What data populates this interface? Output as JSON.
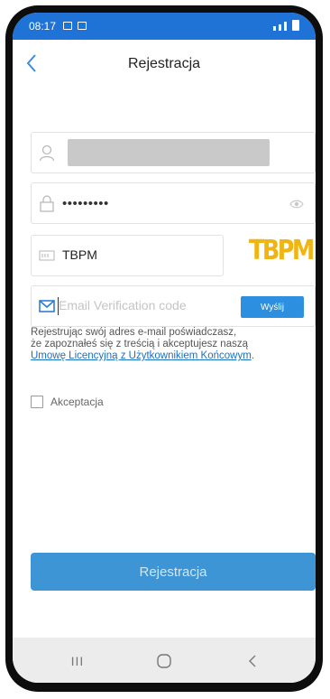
{
  "status_bar": {
    "time": "08:17"
  },
  "header": {
    "title": "Rejestracja",
    "back_icon": "chevron-left-icon"
  },
  "form": {
    "username": {
      "icon": "user-icon",
      "value_redacted": true
    },
    "password": {
      "icon": "lock-icon",
      "value": "•••••••••",
      "toggle_icon": "eye-icon"
    },
    "captcha": {
      "icon": "captcha-icon",
      "value": "TBPM",
      "image_text": "TBPM"
    },
    "email_code": {
      "icon": "mail-icon",
      "placeholder": "Email Verification code",
      "send_label": "Wyślij"
    }
  },
  "consent": {
    "text_line1": "Rejestrując swój adres e-mail poświadczasz,",
    "text_line2": "że zapoznałeś się z treścią i akceptujesz naszą",
    "link_text": "Umowę Licencyjną z Użytkownikiem Końcowym",
    "after_link": "."
  },
  "accept": {
    "label": "Akceptacja",
    "checked": false
  },
  "register_button": {
    "label": "Rejestracja"
  },
  "navbar": {
    "recent_label": "III",
    "home_icon": "home-circle-icon",
    "back_icon": "back-chevron-icon"
  },
  "colors": {
    "status_bar": "#1f73d6",
    "accent": "#3d95d6",
    "link": "#1a6fc1",
    "captcha": "#f0b512"
  }
}
